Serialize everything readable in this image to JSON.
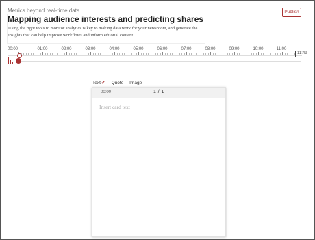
{
  "header": {
    "kicker": "Metrics beyond real-time data",
    "publish_label": "Publish",
    "headline": "Mapping audience interests and predicting shares",
    "description": "Using the right tools to monitor analytics is key to making data work for your newsroom, and generate the insights that can help improve workflows and inform editorial content."
  },
  "timeline": {
    "start_label": "00:00",
    "tick_labels": [
      "01:00",
      "02:00",
      "03:00",
      "04:00",
      "05:00",
      "06:00",
      "07:00",
      "08:00",
      "09:00",
      "10:00",
      "11:00"
    ],
    "end_label": "11:49"
  },
  "editor": {
    "tabs": [
      {
        "label": "Text",
        "active": true
      },
      {
        "label": "Quote",
        "active": false
      },
      {
        "label": "Image",
        "active": false
      }
    ],
    "card_time": "00:00",
    "card_page": "1 / 1",
    "card_placeholder": "Insert card text"
  },
  "colors": {
    "accent": "#a33333"
  }
}
